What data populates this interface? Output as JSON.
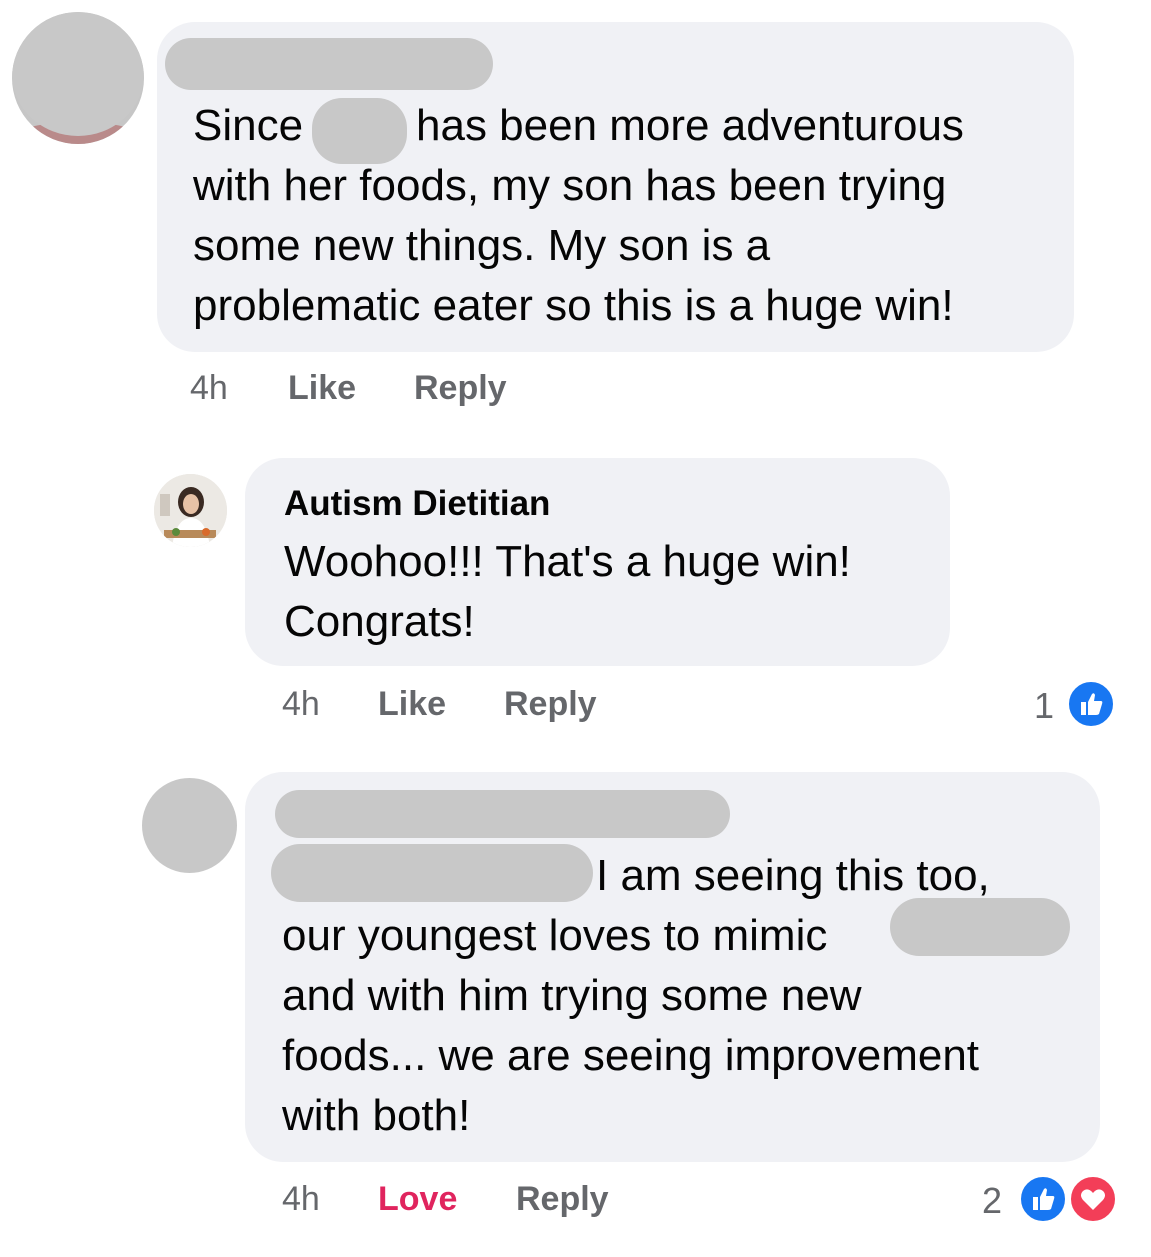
{
  "comment1": {
    "author": "",
    "lines": [
      "Since",
      "has been more adventurous",
      "with her foods, my son has been trying",
      "some new things. My son is a",
      "problematic eater so this is a huge win!"
    ],
    "time": "4h",
    "like_label": "Like",
    "reply_label": "Reply"
  },
  "reply1": {
    "author": "Autism Dietitian",
    "lines": [
      "Woohoo!!! That's a huge win!",
      "Congrats!"
    ],
    "time": "4h",
    "like_label": "Like",
    "reply_label": "Reply",
    "reaction_count": "1",
    "reaction_icons": [
      "like-icon"
    ],
    "like_color": "#1877f2"
  },
  "reply2": {
    "author": "",
    "lines": [
      "I am seeing this too,",
      "our youngest loves to mimic",
      "and with him trying some new",
      "foods... we are seeing improvement",
      "with both!"
    ],
    "time": "4h",
    "love_label": "Love",
    "reply_label": "Reply",
    "reaction_count": "2",
    "reaction_icons": [
      "like-icon",
      "love-icon"
    ],
    "love_color": "#f33e58"
  }
}
